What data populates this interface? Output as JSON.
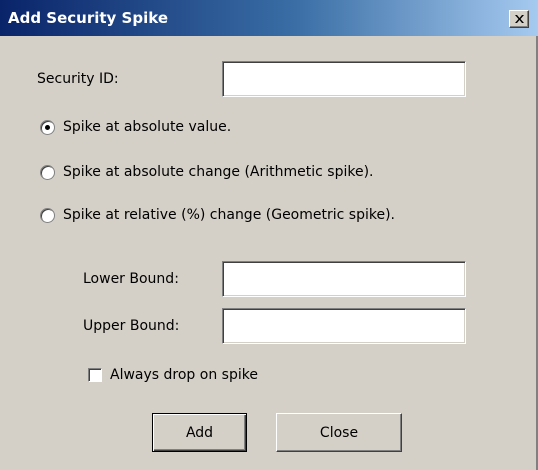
{
  "window": {
    "title": "Add Security Spike"
  },
  "form": {
    "security_id_label": "Security ID:",
    "security_id_value": "",
    "radio_options": [
      {
        "label": "Spike at absolute value.",
        "selected": true
      },
      {
        "label": "Spike at absolute change (Arithmetic spike).",
        "selected": false
      },
      {
        "label": "Spike at relative (%) change (Geometric spike).",
        "selected": false
      }
    ],
    "lower_bound_label": "Lower Bound:",
    "lower_bound_value": "",
    "upper_bound_label": "Upper Bound:",
    "upper_bound_value": "",
    "always_drop_label": "Always drop on spike",
    "always_drop_checked": false
  },
  "buttons": {
    "add_label": "Add",
    "close_label": "Close"
  },
  "icons": {
    "close": "close-icon"
  },
  "colors": {
    "titlebar_start": "#0a246a",
    "titlebar_end": "#a6caf0",
    "dialog_bg": "#d4d0c8"
  }
}
